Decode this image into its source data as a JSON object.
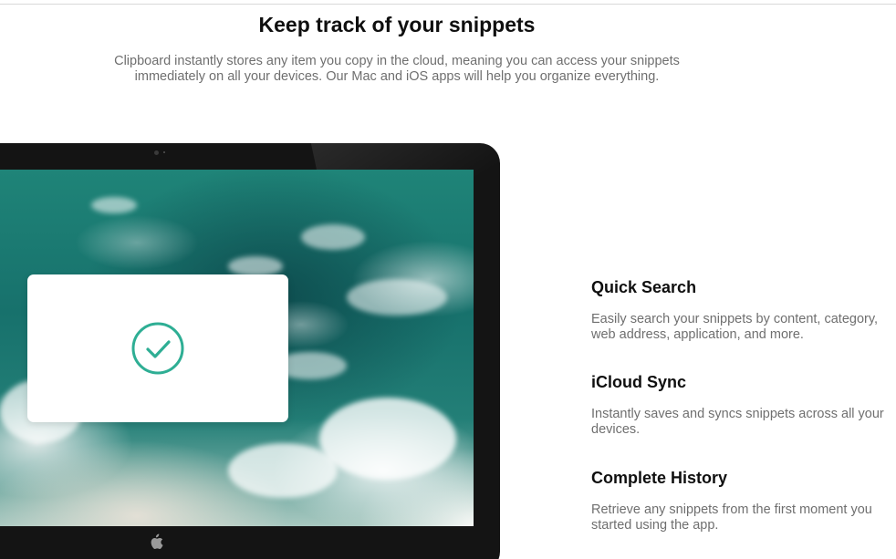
{
  "heading": "Keep track of your snippets",
  "subtitle": "Clipboard instantly stores any item you copy in the cloud, meaning you can access your snippets immediately on all your devices. Our Mac and iOS apps will help you organize everything.",
  "device": {
    "card_icon": "checkmark-circle-icon",
    "logo_icon": "apple-icon",
    "accent_color": "#2eae94"
  },
  "features": [
    {
      "title": "Quick Search",
      "description": "Easily search your snippets by content, category, web address, application, and more."
    },
    {
      "title": "iCloud Sync",
      "description": "Instantly saves and syncs snippets across all your devices."
    },
    {
      "title": "Complete History",
      "description": "Retrieve any snippets from the first moment you started using the app."
    }
  ]
}
